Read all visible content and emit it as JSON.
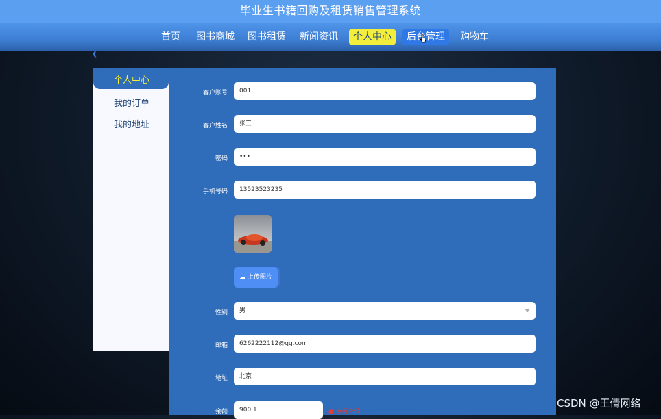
{
  "app": {
    "title": "毕业生书籍回购及租赁销售管理系统"
  },
  "nav": {
    "items": [
      {
        "label": "首页"
      },
      {
        "label": "图书商城"
      },
      {
        "label": "图书租赁"
      },
      {
        "label": "新闻资讯"
      },
      {
        "label": "个人中心"
      },
      {
        "label": "后台管理"
      },
      {
        "label": "购物车"
      }
    ],
    "active_index": 4,
    "hover_index": 5
  },
  "sidebar": {
    "items": [
      {
        "label": "个人中心"
      },
      {
        "label": "我的订单"
      },
      {
        "label": "我的地址"
      }
    ]
  },
  "form": {
    "account": {
      "label": "客户账号",
      "value": "001"
    },
    "name": {
      "label": "客户姓名",
      "value": "张三"
    },
    "password": {
      "label": "密码",
      "value": "•••"
    },
    "phone": {
      "label": "手机号码",
      "value": "13523523235"
    },
    "upload_label": "上传图片",
    "gender": {
      "label": "性别",
      "value": "男"
    },
    "email": {
      "label": "邮箱",
      "value": "6262222112@qq.com"
    },
    "address": {
      "label": "地址",
      "value": "北京"
    },
    "balance": {
      "label": "余额",
      "value": "900.1"
    },
    "recharge_label": "点我充值"
  },
  "watermark": "CSDN @王倩网络",
  "colors": {
    "nav_active": "#f2ee3b",
    "panel": "#2f6cb9",
    "topbar": "#5b9ff0"
  },
  "icons": {
    "upload": "cloud-upload-icon",
    "recharge": "coin-icon",
    "select": "chevron-down-icon"
  }
}
